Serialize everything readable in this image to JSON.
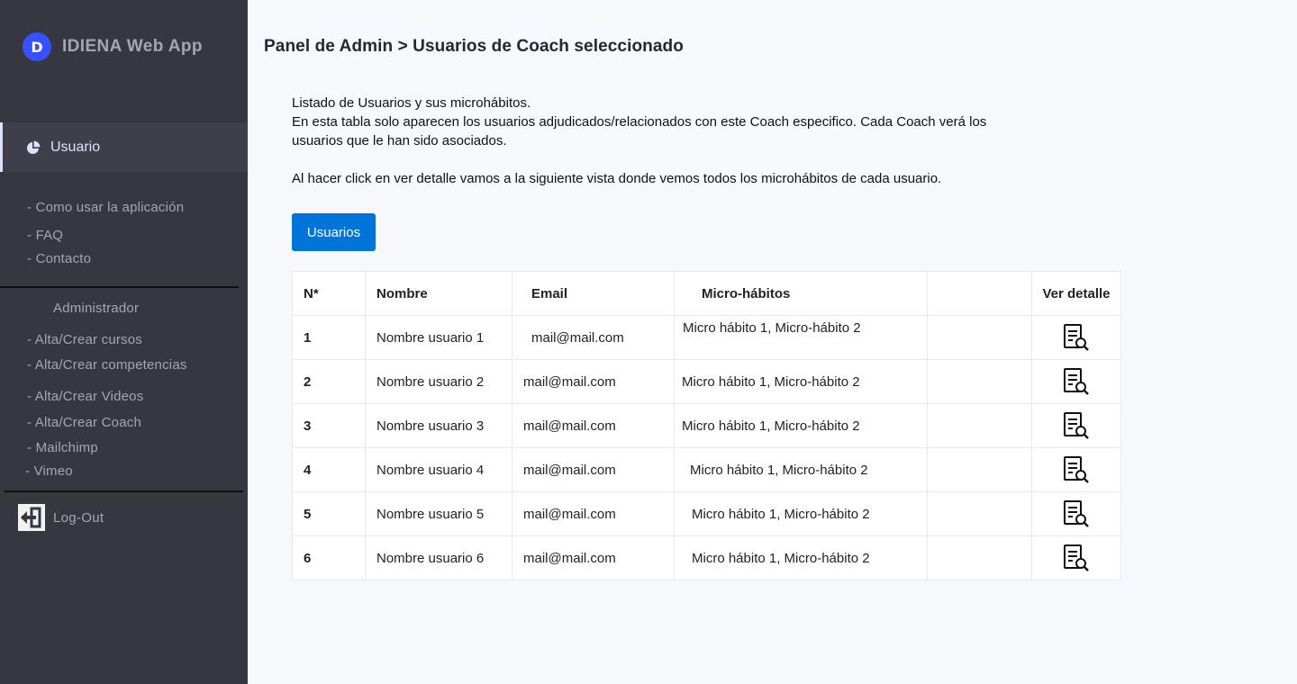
{
  "brand": {
    "logo_letter": "D",
    "title": "IDIENA Web App",
    "accent": "#3751ff"
  },
  "sidebar": {
    "active_item": {
      "label": "Usuario",
      "icon": "pie-chart-icon"
    },
    "help_links": [
      {
        "label": "- Como usar la aplicación"
      },
      {
        "label": "- FAQ"
      },
      {
        "label": "- Contacto"
      }
    ],
    "admin_heading": "Administrador",
    "admin_links": [
      {
        "label": "- Alta/Crear cursos"
      },
      {
        "label": "- Alta/Crear competencias"
      },
      {
        "label": "- Alta/Crear Videos"
      },
      {
        "label": "- Alta/Crear Coach"
      },
      {
        "label": "- Mailchimp"
      },
      {
        "label": "- Vimeo"
      }
    ],
    "logout": {
      "label": "Log-Out",
      "icon": "logout-arrow-icon"
    }
  },
  "main": {
    "title": "Panel de Admin > Usuarios de Coach seleccionado",
    "intro": {
      "line1": "Listado de Usuarios y sus microhábitos.",
      "line2": "En esta tabla solo aparecen los usuarios adjudicados/relacionados con este Coach especifico. Cada Coach verá los usuarios que le han sido asociados.",
      "line3": "Al hacer click en ver detalle vamos a la siguiente vista donde vemos todos los microhábitos de cada usuario."
    },
    "button_label": "Usuarios",
    "button_color": "#0074d9",
    "table": {
      "headers": {
        "n": "N*",
        "nombre": "Nombre",
        "email": "Email",
        "micro": "Micro-hábitos",
        "extra": "",
        "ver": "Ver detalle"
      },
      "rows": [
        {
          "n": "1",
          "nombre": "Nombre usuario 1",
          "email": "mail@mail.com",
          "micro": "Micro hábito 1, Micro-hábito 2"
        },
        {
          "n": "2",
          "nombre": "Nombre usuario 2",
          "email": "mail@mail.com",
          "micro": "Micro hábito 1, Micro-hábito 2"
        },
        {
          "n": "3",
          "nombre": "Nombre usuario 3",
          "email": "mail@mail.com",
          "micro": "Micro hábito 1, Micro-hábito 2"
        },
        {
          "n": "4",
          "nombre": "Nombre usuario 4",
          "email": "mail@mail.com",
          "micro": "Micro hábito 1, Micro-hábito 2"
        },
        {
          "n": "5",
          "nombre": "Nombre usuario 5",
          "email": "mail@mail.com",
          "micro": "Micro hábito 1, Micro-hábito 2"
        },
        {
          "n": "6",
          "nombre": "Nombre usuario 6",
          "email": "mail@mail.com",
          "micro": "Micro hábito 1, Micro-hábito 2"
        }
      ],
      "detail_icon": "document-search-icon"
    }
  }
}
